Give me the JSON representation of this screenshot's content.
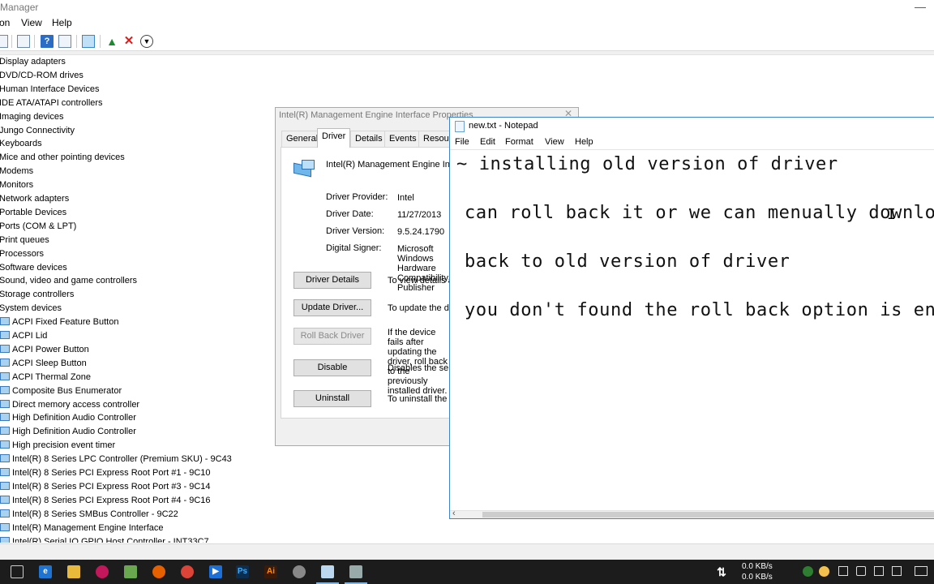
{
  "device_manager": {
    "title": "Manager",
    "menu": [
      "on",
      "View",
      "Help"
    ],
    "tree": {
      "categories": [
        "Display adapters",
        "DVD/CD-ROM drives",
        "Human Interface Devices",
        "IDE ATA/ATAPI controllers",
        "Imaging devices",
        "Jungo Connectivity",
        "Keyboards",
        "Mice and other pointing devices",
        "Modems",
        "Monitors",
        "Network adapters",
        "Portable Devices",
        "Ports (COM & LPT)",
        "Print queues",
        "Processors",
        "Software devices",
        "Sound, video and game controllers",
        "Storage controllers",
        "System devices"
      ],
      "system_devices": [
        "ACPI Fixed Feature Button",
        "ACPI Lid",
        "ACPI Power Button",
        "ACPI Sleep Button",
        "ACPI Thermal Zone",
        "Composite Bus Enumerator",
        "Direct memory access controller",
        "High Definition Audio Controller",
        "High Definition Audio Controller",
        "High precision event timer",
        "Intel(R) 8 Series LPC Controller (Premium SKU) - 9C43",
        "Intel(R) 8 Series PCI Express Root Port #1 - 9C10",
        "Intel(R) 8 Series PCI Express Root Port #3 - 9C14",
        "Intel(R) 8 Series PCI Express Root Port #4 - 9C16",
        "Intel(R) 8 Series SMBus Controller - 9C22",
        "Intel(R) Management Engine Interface",
        "Intel(R) Serial IO GPIO Host Controller - INT33C7"
      ]
    }
  },
  "properties": {
    "title": "Intel(R) Management Engine Interface  Properties",
    "tabs": [
      "General",
      "Driver",
      "Details",
      "Events",
      "Resources"
    ],
    "active_tab": "Driver",
    "device_name": "Intel(R) Management Engine Interface",
    "info": [
      {
        "label": "Driver Provider:",
        "value": "Intel"
      },
      {
        "label": "Driver Date:",
        "value": "11/27/2013"
      },
      {
        "label": "Driver Version:",
        "value": "9.5.24.1790"
      },
      {
        "label": "Digital Signer:",
        "value": "Microsoft Windows Hardware Compatibility Publisher"
      }
    ],
    "buttons": [
      {
        "label": "Driver Details",
        "desc": "To view details about the driver files."
      },
      {
        "label": "Update Driver...",
        "desc": "To update the driver software for this device."
      },
      {
        "label": "Roll Back Driver",
        "desc": "If the device fails after updating the driver, roll back to the previously installed driver."
      },
      {
        "label": "Disable",
        "desc": "Disables the selected device."
      },
      {
        "label": "Uninstall",
        "desc": "To uninstall the driver (Advanced)."
      }
    ]
  },
  "notepad": {
    "title": "new.txt - Notepad",
    "menu": [
      "File",
      "Edit",
      "Format",
      "View",
      "Help"
    ],
    "lines": [
      "~ installing old version of driver",
      "can roll back it or we can menually download",
      "back to old version of driver",
      "you don't found the roll back option is enabled"
    ]
  },
  "taskbar": {
    "upload_speed": "0.0 KB/s",
    "download_speed": "0.0 KB/s",
    "apps": [
      "task-view",
      "edge",
      "file-explorer",
      "app-red",
      "android",
      "firefox",
      "chrome",
      "media",
      "photoshop",
      "illustrator",
      "settings",
      "notepad",
      "device-manager"
    ]
  },
  "colors": {
    "accent_blue": "#3f85c6",
    "taskbar": "#1c1c1c",
    "dialog_bg": "#f0f0f0"
  }
}
